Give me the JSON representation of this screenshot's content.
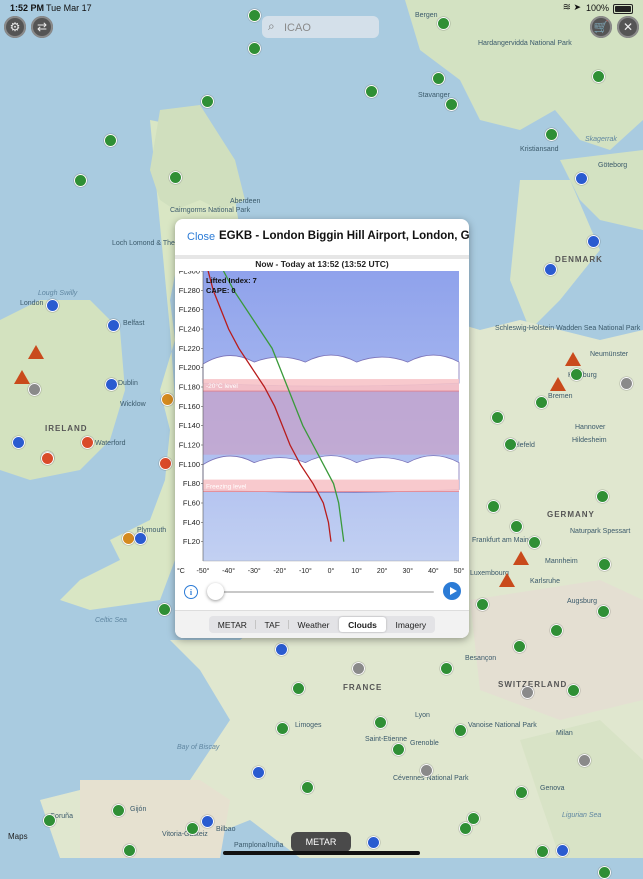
{
  "status_bar": {
    "time": "1:52 PM",
    "date": "Tue Mar 17",
    "battery": "100%"
  },
  "top_controls": {
    "left_icons": [
      "settings-icon",
      "refresh-icon"
    ],
    "right_icons": [
      "cart-icon",
      "tools-icon"
    ]
  },
  "search": {
    "placeholder": "ICAO"
  },
  "map_labels": {
    "cities": [
      "Bergen",
      "Stavanger",
      "Aberdeen",
      "Belfast",
      "Dublin",
      "Kristiansand",
      "Göteborg",
      "Hamburg",
      "Bremen",
      "Bielefeld",
      "Hildesheim",
      "Hannover",
      "Frankfurt am Main",
      "Mannheim",
      "Karlsruhe",
      "Augsburg",
      "Luxembourg",
      "Besançon",
      "Lyon",
      "Limoges",
      "Saint-Etienne",
      "Grenoble",
      "Milan",
      "Genova",
      "Bilbao",
      "Gijón",
      "Coruña",
      "Vitoria-Gasteiz",
      "Pamplona/Iruña",
      "Plymouth",
      "Wicklow",
      "Waterford",
      "London",
      "Neumünster"
    ],
    "regions": [
      "IRELAND",
      "DENMARK",
      "GERMANY",
      "FRANCE",
      "SWITZERLAND"
    ],
    "seas": [
      "Skagerrak",
      "Celtic Sea",
      "Bay of Biscay",
      "Ligurian Sea",
      "Lough Swilly"
    ],
    "parks": [
      "Cairngorms National Park",
      "Hardangervidda National Park",
      "Loch Lomond & The Trossachs National Park",
      "Schleswig-Holstein Wadden Sea National Park",
      "Naturpark Spessart",
      "Vanoise National Park",
      "Cévennes National Park"
    ]
  },
  "panel": {
    "close_label": "Close",
    "title": "EGKB - London Biggin Hill Airport, London, GB",
    "subtitle": "Now - Today at 13:52 (13:52 UTC)",
    "tabs": [
      {
        "label": "METAR",
        "active": false
      },
      {
        "label": "TAF",
        "active": false
      },
      {
        "label": "Weather",
        "active": false
      },
      {
        "label": "Clouds",
        "active": true
      },
      {
        "label": "Imagery",
        "active": false
      }
    ],
    "timeline_position": 0
  },
  "chart_data": {
    "type": "line",
    "annotations": [
      "Lifted Index: 7",
      "CAPE: 0",
      "-20°C level",
      "Freezing level"
    ],
    "y_ticks": [
      "FL20",
      "FL40",
      "FL60",
      "FL80",
      "FL100",
      "FL120",
      "FL140",
      "FL160",
      "FL180",
      "FL200",
      "FL220",
      "FL240",
      "FL260",
      "FL280",
      "FL300"
    ],
    "x_unit_label": "°C",
    "x_ticks": [
      "-50°",
      "-40°",
      "-30°",
      "-20°",
      "-10°",
      "0°",
      "10°",
      "20°",
      "30°",
      "40°",
      "50°"
    ],
    "xlim": [
      -50,
      50
    ],
    "ylim": [
      0,
      300
    ],
    "series": [
      {
        "color": "#b81c1c",
        "x": [
          0,
          -1,
          -3,
          -7,
          -12,
          -16,
          -19,
          -22,
          -26,
          -31,
          -36,
          -40,
          -43,
          -46,
          -48
        ],
        "y": [
          20,
          40,
          60,
          80,
          100,
          120,
          140,
          160,
          180,
          200,
          220,
          240,
          260,
          280,
          300
        ]
      },
      {
        "color": "#3a9a3a",
        "x": [
          5,
          4,
          3,
          1,
          -3,
          -7,
          -11,
          -14,
          -17,
          -20,
          -23,
          -28,
          -33,
          -38,
          -42
        ],
        "y": [
          20,
          40,
          60,
          80,
          100,
          120,
          140,
          160,
          180,
          200,
          220,
          240,
          260,
          280,
          300
        ]
      }
    ],
    "bands": [
      {
        "name": "-20°C level",
        "level": 182
      },
      {
        "name": "Freezing level",
        "level": 78
      }
    ],
    "cloud_layers": [
      [
        184,
        212
      ],
      [
        74,
        108
      ]
    ],
    "inversion_layer": [
      110,
      182
    ],
    "colors": {
      "upper_sky": "#8fa2ec",
      "lower_sky": "#c2d0f2",
      "cloud": "#ffffff",
      "band": "#f7c3c8",
      "inversion": "#c7a3c9"
    }
  },
  "bottom": {
    "metar_button": "METAR",
    "maps_logo": "Maps"
  }
}
